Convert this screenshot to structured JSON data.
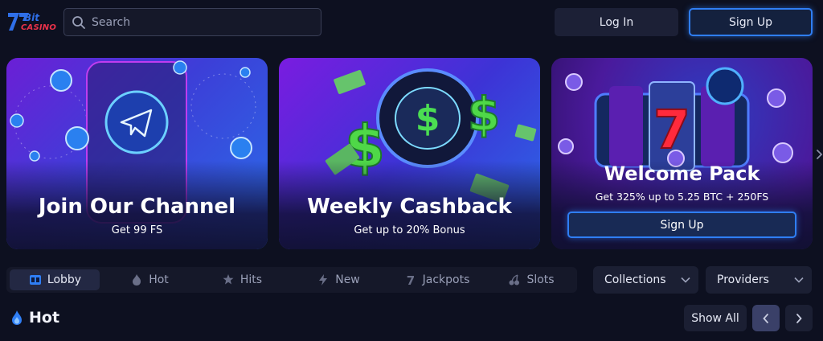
{
  "header": {
    "logo_text": "CASINO",
    "search_placeholder": "Search",
    "login_label": "Log In",
    "signup_label": "Sign Up"
  },
  "banners": [
    {
      "title": "Join Our Channel",
      "subtitle": "Get 99 FS",
      "icon": "telegram-icon"
    },
    {
      "title": "Weekly Cashback",
      "subtitle": "Get up to 20% Bonus",
      "icon": "dollar-icon"
    },
    {
      "title": "Welcome Pack",
      "subtitle": "Get 325% up to 5.25 BTC + 250FS",
      "cta": "Sign Up",
      "icon": "slot-seven-icon"
    }
  ],
  "tabs": [
    {
      "label": "Lobby",
      "icon": "lobby-icon",
      "active": true
    },
    {
      "label": "Hot",
      "icon": "flame-icon",
      "active": false
    },
    {
      "label": "Hits",
      "icon": "stars-icon",
      "active": false
    },
    {
      "label": "New",
      "icon": "bolt-icon",
      "active": false
    },
    {
      "label": "Jackpots",
      "icon": "jackpot-icon",
      "active": false
    },
    {
      "label": "Slots",
      "icon": "cherry-icon",
      "active": false
    }
  ],
  "filters": {
    "collections_label": "Collections",
    "providers_label": "Providers"
  },
  "section": {
    "title": "Hot",
    "show_all_label": "Show All"
  },
  "colors": {
    "background": "#0d1020",
    "accent_blue": "#2f7ef5",
    "logo_red": "#e9324a",
    "logo_blue": "#2f6fe8"
  }
}
